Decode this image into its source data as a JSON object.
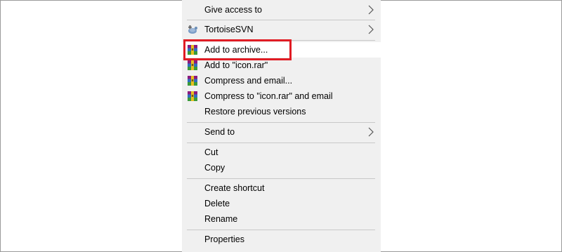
{
  "menu": {
    "items": [
      {
        "label": "Give access to",
        "submenu": true
      },
      {
        "label": "TortoiseSVN",
        "submenu": true,
        "icon": "tortoisesvn-icon"
      },
      {
        "label": "Add to archive...",
        "icon": "winrar-icon",
        "highlighted": true
      },
      {
        "label": "Add to \"icon.rar\"",
        "icon": "winrar-icon"
      },
      {
        "label": "Compress and email...",
        "icon": "winrar-icon"
      },
      {
        "label": "Compress to \"icon.rar\" and email",
        "icon": "winrar-icon"
      },
      {
        "label": "Restore previous versions"
      },
      {
        "label": "Send to",
        "submenu": true
      },
      {
        "label": "Cut"
      },
      {
        "label": "Copy"
      },
      {
        "label": "Create shortcut"
      },
      {
        "label": "Delete"
      },
      {
        "label": "Rename"
      },
      {
        "label": "Properties"
      }
    ]
  },
  "colors": {
    "menu_bg": "#f0f0f0",
    "highlight_border": "#e01c24",
    "separator": "#c8c8c8"
  }
}
